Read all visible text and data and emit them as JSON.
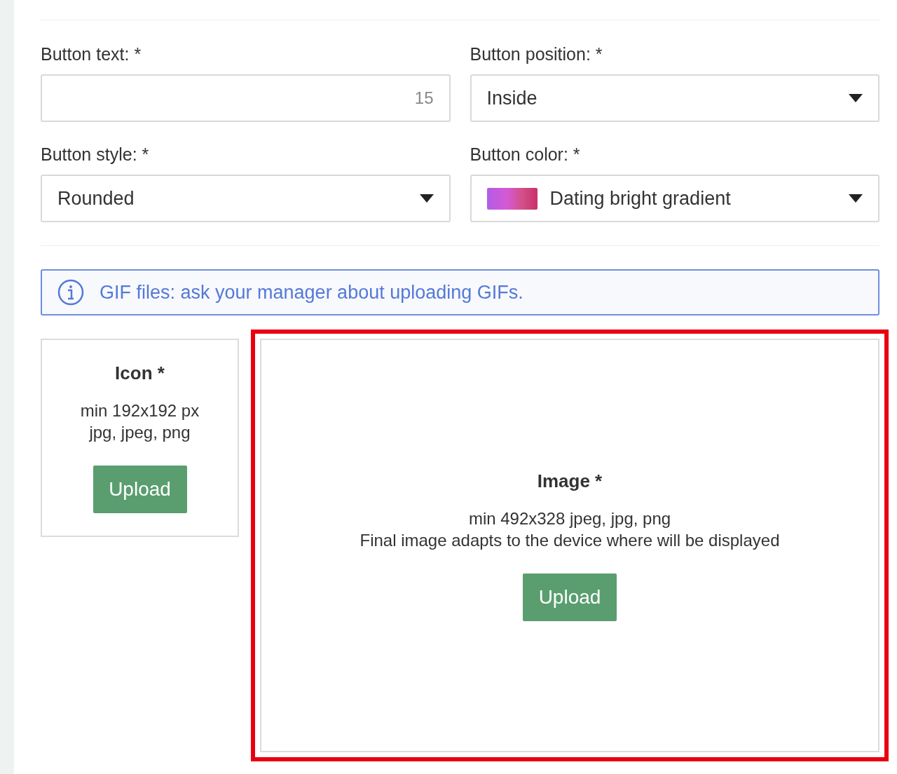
{
  "fields": [
    {
      "kind": "text",
      "label": "Button text: *",
      "counter": "15"
    },
    {
      "kind": "select",
      "label": "Button position: *",
      "value": "Inside"
    },
    {
      "kind": "select",
      "label": "Button style: *",
      "value": "Rounded"
    },
    {
      "kind": "color-select",
      "label": "Button color: *",
      "value": "Dating bright gradient"
    }
  ],
  "notice": {
    "text": "GIF files: ask your manager about uploading GIFs."
  },
  "uploads": [
    {
      "kind": "icon",
      "title": "Icon *",
      "lines": [
        "min 192x192 px",
        "jpg, jpeg, png"
      ],
      "button": "Upload"
    },
    {
      "kind": "image",
      "title": "Image *",
      "lines": [
        "min 492x328 jpeg, jpg, png",
        "Final image adapts to the device where will be displayed"
      ],
      "button": "Upload",
      "highlighted": true
    }
  ]
}
